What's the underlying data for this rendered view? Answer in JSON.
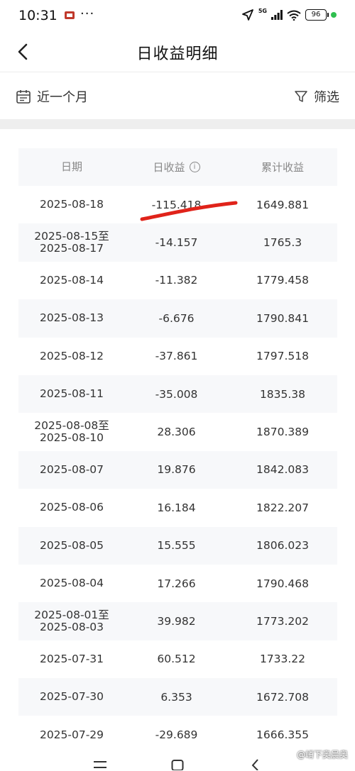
{
  "status_bar": {
    "time": "10:31",
    "dots": "···",
    "network": "5G",
    "battery": "96"
  },
  "header": {
    "title": "日收益明细"
  },
  "filter": {
    "period": "近一个月",
    "filter_label": "筛选"
  },
  "table": {
    "columns": [
      "日期",
      "日收益",
      "累计收益"
    ],
    "rows": [
      {
        "date": "2025-08-18",
        "daily": "-115.418",
        "total": "1649.881"
      },
      {
        "date": "2025-08-15至2025-08-17",
        "daily": "-14.157",
        "total": "1765.3"
      },
      {
        "date": "2025-08-14",
        "daily": "-11.382",
        "total": "1779.458"
      },
      {
        "date": "2025-08-13",
        "daily": "-6.676",
        "total": "1790.841"
      },
      {
        "date": "2025-08-12",
        "daily": "-37.861",
        "total": "1797.518"
      },
      {
        "date": "2025-08-11",
        "daily": "-35.008",
        "total": "1835.38"
      },
      {
        "date": "2025-08-08至2025-08-10",
        "daily": "28.306",
        "total": "1870.389"
      },
      {
        "date": "2025-08-07",
        "daily": "19.876",
        "total": "1842.083"
      },
      {
        "date": "2025-08-06",
        "daily": "16.184",
        "total": "1822.207"
      },
      {
        "date": "2025-08-05",
        "daily": "15.555",
        "total": "1806.023"
      },
      {
        "date": "2025-08-04",
        "daily": "17.266",
        "total": "1790.468"
      },
      {
        "date": "2025-08-01至2025-08-03",
        "daily": "39.982",
        "total": "1773.202"
      },
      {
        "date": "2025-07-31",
        "daily": "60.512",
        "total": "1733.22"
      },
      {
        "date": "2025-07-30",
        "daily": "6.353",
        "total": "1672.708"
      },
      {
        "date": "2025-07-29",
        "daily": "-29.689",
        "total": "1666.355"
      }
    ]
  },
  "watermark": "@嵴下奥晨奥",
  "colors": {
    "annotation_red": "#e0231a",
    "row_alt": "#f7f8fa",
    "status_green": "#2fbf4f"
  },
  "icons": {
    "back": "chevron-left-icon",
    "calendar": "calendar-icon",
    "filter": "funnel-icon",
    "info": "info-icon"
  }
}
